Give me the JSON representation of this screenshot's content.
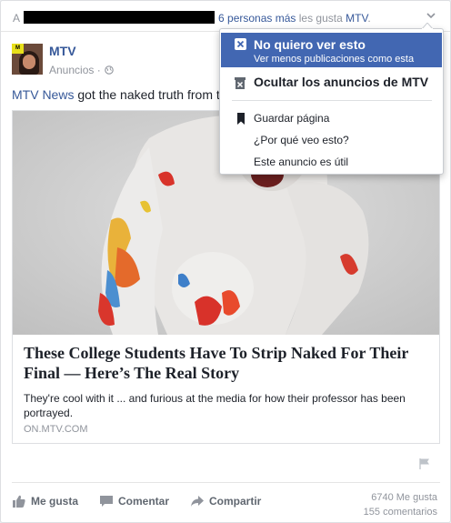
{
  "story": {
    "prefix": "A",
    "likes_link": "6 personas más",
    "likes_text": " les gusta ",
    "page_link": "MTV",
    "period": "."
  },
  "post": {
    "page_name": "MTV",
    "sponsored": "Anuncios ·",
    "text_link": "MTV News",
    "text": " got the naked truth from t"
  },
  "link_card": {
    "title": "These College Students Have To Strip Naked For Their Final — Here’s The Real Story",
    "description": "They're cool with it ... and furious at the media for how their professor has been portrayed.",
    "domain": "ON.MTV.COM"
  },
  "actions": {
    "like": "Me gusta",
    "comment": "Comentar",
    "share": "Compartir"
  },
  "stats": {
    "likes": "6740 Me gusta",
    "comments": "155 comentarios"
  },
  "menu": {
    "hide_post_title": "No quiero ver esto",
    "hide_post_subtitle": "Ver menos publicaciones como esta",
    "hide_ads": "Ocultar los anuncios de MTV",
    "save_page": "Guardar página",
    "why": "¿Por qué veo esto?",
    "useful": "Este anuncio es útil"
  },
  "avatar_badge": "M",
  "colors": {
    "link": "#365899",
    "menu_highlight": "#4267b2",
    "secondary_text": "#90949c"
  }
}
